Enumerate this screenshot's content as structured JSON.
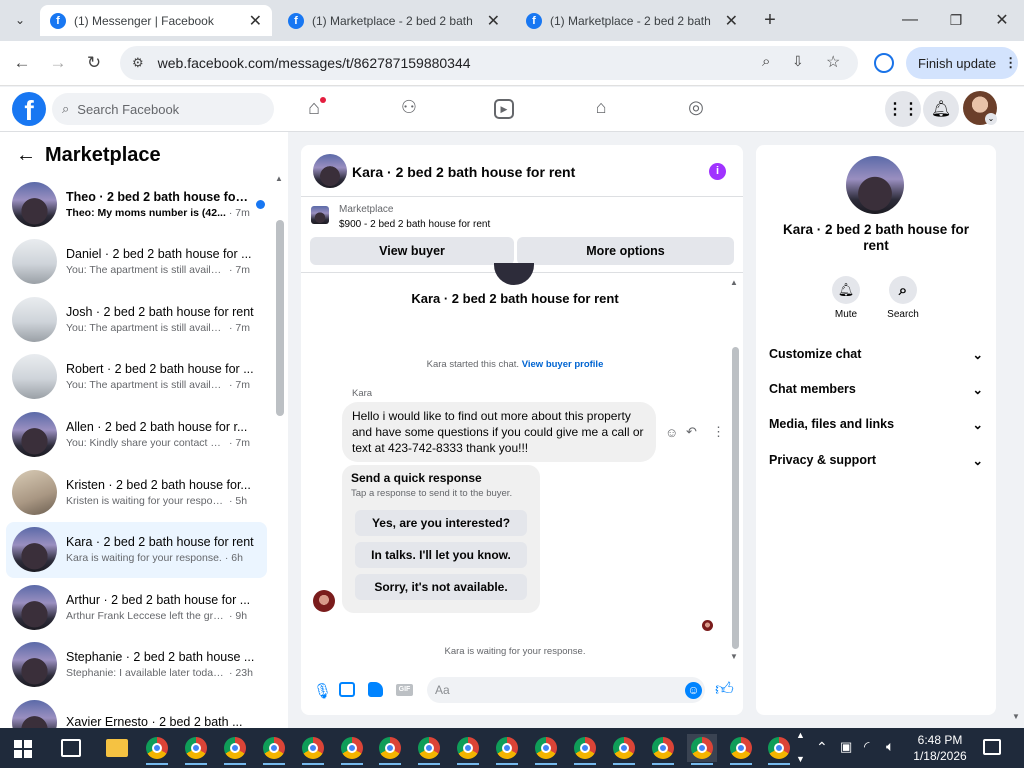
{
  "browser": {
    "tabs": [
      {
        "title": "(1) Messenger | Facebook",
        "active": true
      },
      {
        "title": "(1) Marketplace - 2 bed 2 bath",
        "active": false
      },
      {
        "title": "(1) Marketplace - 2 bed 2 bath",
        "active": false
      }
    ],
    "url": "web.facebook.com/messages/t/862787159880344",
    "finish_update_label": "Finish update"
  },
  "fb_header": {
    "logo_letter": "f",
    "search_placeholder": "Search Facebook"
  },
  "sidebar": {
    "title": "Marketplace",
    "conversations": [
      {
        "name": "Theo · 2 bed 2 bath house for ...",
        "preview": "Theo: My moms number is (42...",
        "time": "· 7m",
        "unread": true,
        "avatar": "house",
        "bold": true
      },
      {
        "name": "Daniel · 2 bed 2 bath house for ...",
        "preview": "You: The apartment is still availabl...",
        "time": "· 7m",
        "avatar": "room"
      },
      {
        "name": "Josh · 2 bed 2 bath house for rent",
        "preview": "You: The apartment is still availabl...",
        "time": "· 7m",
        "avatar": "room"
      },
      {
        "name": "Robert · 2 bed 2 bath house for ...",
        "preview": "You: The apartment is still availabl...",
        "time": "· 7m",
        "avatar": "room"
      },
      {
        "name": "Allen · 2 bed 2 bath house for r...",
        "preview": "You: Kindly share your contact nu...",
        "time": "· 7m",
        "avatar": "house"
      },
      {
        "name": "Kristen · 2 bed 2 bath house for...",
        "preview": "Kristen is waiting for your response.",
        "time": "· 5h",
        "avatar": "kitchen"
      },
      {
        "name": "Kara · 2 bed 2 bath house for rent",
        "preview": "Kara is waiting for your response.",
        "time": "· 6h",
        "avatar": "house",
        "selected": true
      },
      {
        "name": "Arthur · 2 bed 2 bath house for ...",
        "preview": "Arthur Frank Leccese left the group.",
        "time": "· 9h",
        "avatar": "house"
      },
      {
        "name": "Stephanie · 2 bed 2 bath house ...",
        "preview": "Stephanie: I available later today i...",
        "time": "· 23h",
        "avatar": "house"
      },
      {
        "name": "Xavier Ernesto · 2 bed 2 bath ...",
        "preview": "",
        "time": "",
        "avatar": "house"
      }
    ]
  },
  "chat": {
    "title": "Kara · 2 bed 2 bath house for rent",
    "listing_source": "Marketplace",
    "listing_text": "$900 - 2 bed 2 bath house for rent",
    "view_buyer_label": "View buyer",
    "more_options_label": "More options",
    "intro_title": "Kara · 2 bed 2 bath house for rent",
    "started_text": "Kara started this chat.",
    "view_buyer_profile": "View buyer profile",
    "sender_name": "Kara",
    "message": "Hello i would like to find out more about this property and have some questions if you could give me a call or text at 423-742-8333 thank you!!!",
    "quick_title": "Send a quick response",
    "quick_subtitle": "Tap a response to send it to the buyer.",
    "quick_responses": [
      "Yes, are you interested?",
      "In talks. I'll let you know.",
      "Sorry, it's not available."
    ],
    "waiting_text": "Kara is waiting for your response.",
    "input_placeholder": "Aa"
  },
  "info_panel": {
    "title": "Kara · 2 bed 2 bath house for rent",
    "mute_label": "Mute",
    "search_label": "Search",
    "sections": [
      "Customize chat",
      "Chat members",
      "Media, files and links",
      "Privacy & support"
    ]
  },
  "taskbar": {
    "time": "6:48 PM",
    "date": "1/18/2026",
    "chrome_count": 17
  },
  "colors": {
    "fb_blue": "#1877f2",
    "accent_purple": "#a033ff"
  }
}
